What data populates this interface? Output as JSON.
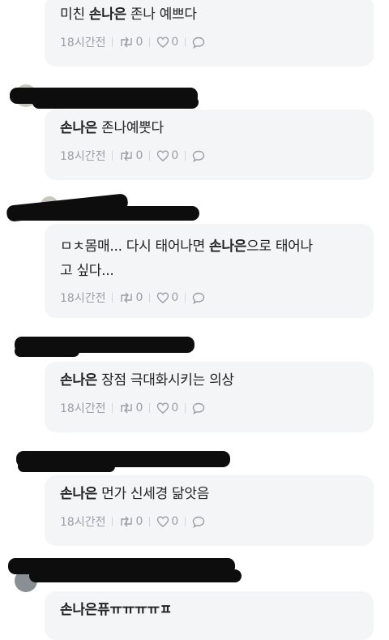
{
  "time_label": "18시간전",
  "comments": [
    {
      "pre": "미친 ",
      "bold": "손나은",
      "post": " 존나 예쁘다",
      "line2": "",
      "retweets": "0",
      "likes": "0"
    },
    {
      "pre": "",
      "bold": "손나은",
      "post": " 존나예뿟다",
      "line2": "",
      "retweets": "0",
      "likes": "0"
    },
    {
      "pre": "ㅁㅊ몸매... 다시 태어나면 ",
      "bold": "손나은",
      "post": "으로 태어나",
      "line2": "고 싶다...",
      "retweets": "0",
      "likes": "0"
    },
    {
      "pre": "",
      "bold": "손나은",
      "post": " 장점 극대화시키는 의상",
      "line2": "",
      "retweets": "0",
      "likes": "0"
    },
    {
      "pre": "",
      "bold": "손나은",
      "post": " 먼가 신세경 닮앗음",
      "line2": "",
      "retweets": "0",
      "likes": "0"
    },
    {
      "pre": "",
      "bold": "손나은퓨ㅠㅠㅠㅠㅍ",
      "post": "",
      "line2": "",
      "retweets": "",
      "likes": ""
    }
  ],
  "icons": {
    "retweet": "retweet-icon",
    "like": "heart-icon",
    "reply": "reply-bubble-icon"
  },
  "colors": {
    "bubble": "#f4f5f7",
    "meta_text": "#9a9ea6",
    "redaction": "#0d0d0d"
  }
}
